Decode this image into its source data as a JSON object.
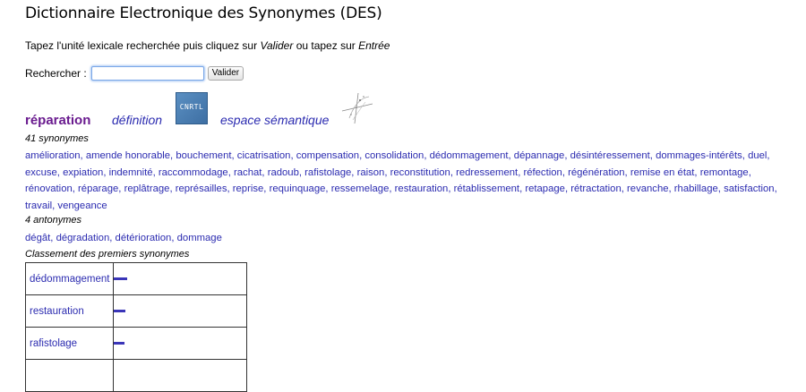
{
  "header": {
    "title": "Dictionnaire Electronique des Synonymes (DES)"
  },
  "instructions": {
    "prefix": "Tapez l'unité lexicale recherchée puis cliquez sur ",
    "valider": "Valider",
    "middle": " ou tapez sur ",
    "entree": "Entrée"
  },
  "search": {
    "label": "Rechercher :",
    "value": "",
    "placeholder": "",
    "button_label": "Valider"
  },
  "entry": {
    "headword": "réparation",
    "definition_link": "définition",
    "cnrtl_logo": "CNRTL",
    "semantic_link": "espace sémantique",
    "semantic_icon": "semantic-space-icon"
  },
  "synonyms": {
    "count_label": "41 synonymes",
    "items": [
      "amélioration",
      "amende honorable",
      "bouchement",
      "cicatrisation",
      "compensation",
      "consolidation",
      "dédommagement",
      "dépannage",
      "désintéressement",
      "dommages-intérêts",
      "duel",
      "excuse",
      "expiation",
      "indemnité",
      "raccommodage",
      "rachat",
      "radoub",
      "rafistolage",
      "raison",
      "reconstitution",
      "redressement",
      "réfection",
      "régénération",
      "remise en état",
      "remontage",
      "rénovation",
      "réparage",
      "replâtrage",
      "représailles",
      "reprise",
      "requinquage",
      "ressemelage",
      "restauration",
      "rétablissement",
      "retapage",
      "rétractation",
      "revanche",
      "rhabillage",
      "satisfaction",
      "travail",
      "vengeance"
    ]
  },
  "antonyms": {
    "count_label": "4 antonymes",
    "items": [
      "dégât",
      "dégradation",
      "détérioration",
      "dommage"
    ]
  },
  "ranking": {
    "label": "Classement des premiers synonymes",
    "rows": [
      {
        "word": "dédommagement",
        "score": 0.1
      },
      {
        "word": "restauration",
        "score": 0.09
      },
      {
        "word": "rafistolage",
        "score": 0.08
      }
    ]
  },
  "colors": {
    "link": "#2b2bb0",
    "headword": "#6a1b8f",
    "bar": "#3a35b8"
  }
}
